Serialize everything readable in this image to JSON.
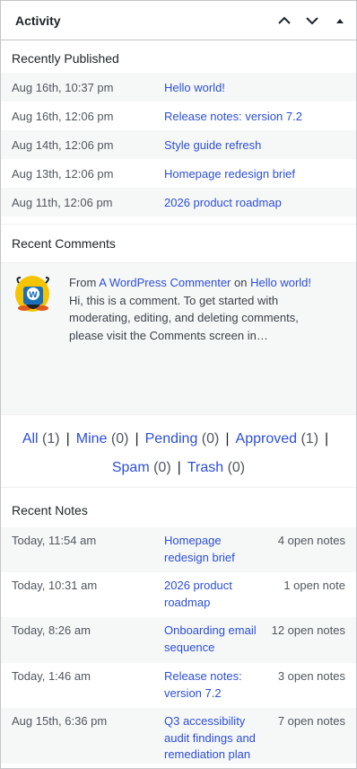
{
  "widget": {
    "title": "Activity",
    "move_up_label": "Move up",
    "move_down_label": "Move down",
    "toggle_label": "Toggle panel"
  },
  "published": {
    "heading": "Recently Published",
    "items": [
      {
        "date": "Aug 16th, 10:37 pm",
        "title": "Hello world!"
      },
      {
        "date": "Aug 16th, 12:06 pm",
        "title": "Release notes: version 7.2"
      },
      {
        "date": "Aug 14th, 12:06 pm",
        "title": "Style guide refresh"
      },
      {
        "date": "Aug 13th, 12:06 pm",
        "title": "Homepage redesign brief"
      },
      {
        "date": "Aug 11th, 12:06 pm",
        "title": "2026 product roadmap"
      }
    ]
  },
  "comments": {
    "heading": "Recent Comments",
    "from_prefix": "From",
    "author": "A WordPress Commenter",
    "on_word": "on",
    "post": "Hello world!",
    "excerpt": "Hi, this is a comment. To get started with moderating, editing, and deleting comments, please visit the Comments screen in…"
  },
  "filters": {
    "all_label": "All",
    "all_count": "(1)",
    "mine_label": "Mine",
    "mine_count": "(0)",
    "pending_label": "Pending",
    "pending_count": "(0)",
    "approved_label": "Approved",
    "approved_count": "(1)",
    "spam_label": "Spam",
    "spam_count": "(0)",
    "trash_label": "Trash",
    "trash_count": "(0)",
    "separator": "|"
  },
  "notes": {
    "heading": "Recent Notes",
    "items": [
      {
        "date": "Today, 11:54 am",
        "title": "Homepage redesign brief",
        "count": "4 open notes"
      },
      {
        "date": "Today, 10:31 am",
        "title": "2026 product roadmap",
        "count": "1 open note"
      },
      {
        "date": "Today, 8:26 am",
        "title": "Onboarding email sequence",
        "count": "12 open notes"
      },
      {
        "date": "Today, 1:46 am",
        "title": "Release notes: version 7.2",
        "count": "3 open notes"
      },
      {
        "date": "Aug 15th, 6:36 pm",
        "title": "Q3 accessibility audit findings and remediation plan",
        "count": "7 open notes"
      }
    ]
  },
  "colors": {
    "link": "#2c4fd8",
    "row_alt": "#f6f7f7",
    "border": "#c3c4c7"
  }
}
